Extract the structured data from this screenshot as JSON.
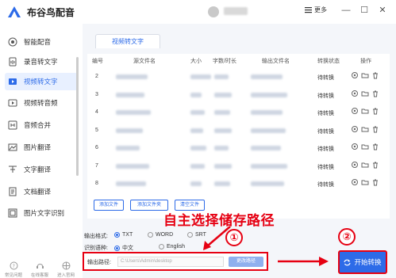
{
  "app": {
    "title": "布谷鸟配音",
    "more_label": "更多"
  },
  "sidebar": {
    "items": [
      {
        "label": "智能配音",
        "icon": "mic-icon",
        "active": false
      },
      {
        "label": "录音转文字",
        "icon": "audio-file-icon",
        "active": false
      },
      {
        "label": "视频转文字",
        "icon": "video-file-icon",
        "active": true
      },
      {
        "label": "视频转音频",
        "icon": "video-audio-icon",
        "active": false
      },
      {
        "label": "音频合并",
        "icon": "merge-icon",
        "active": false
      },
      {
        "label": "图片翻译",
        "icon": "image-translate-icon",
        "active": false
      },
      {
        "label": "文字翻译",
        "icon": "text-translate-icon",
        "active": false
      },
      {
        "label": "文档翻译",
        "icon": "doc-translate-icon",
        "active": false
      },
      {
        "label": "图片文字识别",
        "icon": "ocr-icon",
        "active": false
      }
    ],
    "bottom": [
      {
        "label": "常见问题",
        "icon": "help-icon"
      },
      {
        "label": "在线客服",
        "icon": "service-icon"
      },
      {
        "label": "进入官网",
        "icon": "website-icon"
      }
    ]
  },
  "main": {
    "tab_label": "视频转文字",
    "columns": [
      "编号",
      "源文件名",
      "大小",
      "字数/时长",
      "输出文件名",
      "转换状态",
      "操作"
    ],
    "rows": [
      {
        "num": "2",
        "status": "待转换"
      },
      {
        "num": "3",
        "status": "待转换"
      },
      {
        "num": "4",
        "status": "待转换"
      },
      {
        "num": "5",
        "status": "待转换"
      },
      {
        "num": "6",
        "status": "待转换"
      },
      {
        "num": "7",
        "status": "待转换"
      },
      {
        "num": "8",
        "status": "待转换"
      }
    ],
    "buttons": {
      "add_file": "添加文件",
      "add_folder": "添加文件夹",
      "clear": "清空文件"
    },
    "output_format": {
      "label": "输出格式:",
      "options": [
        "TXT",
        "WORD",
        "SRT"
      ],
      "selected": "TXT"
    },
    "recognition_lang": {
      "label": "识别语种:",
      "options": [
        "中文",
        "English"
      ],
      "selected": "中文"
    },
    "output_path": {
      "label": "输出路径:",
      "placeholder": "C:\\Users\\Admin\\desktop",
      "change_label": "更改路径"
    },
    "start_label": "开始转换"
  },
  "annotation": {
    "text": "自主选择储存路径",
    "step1": "①",
    "step2": "②",
    "color": "#e60012"
  },
  "colors": {
    "accent": "#2d6be8",
    "annotation": "#e60012"
  }
}
